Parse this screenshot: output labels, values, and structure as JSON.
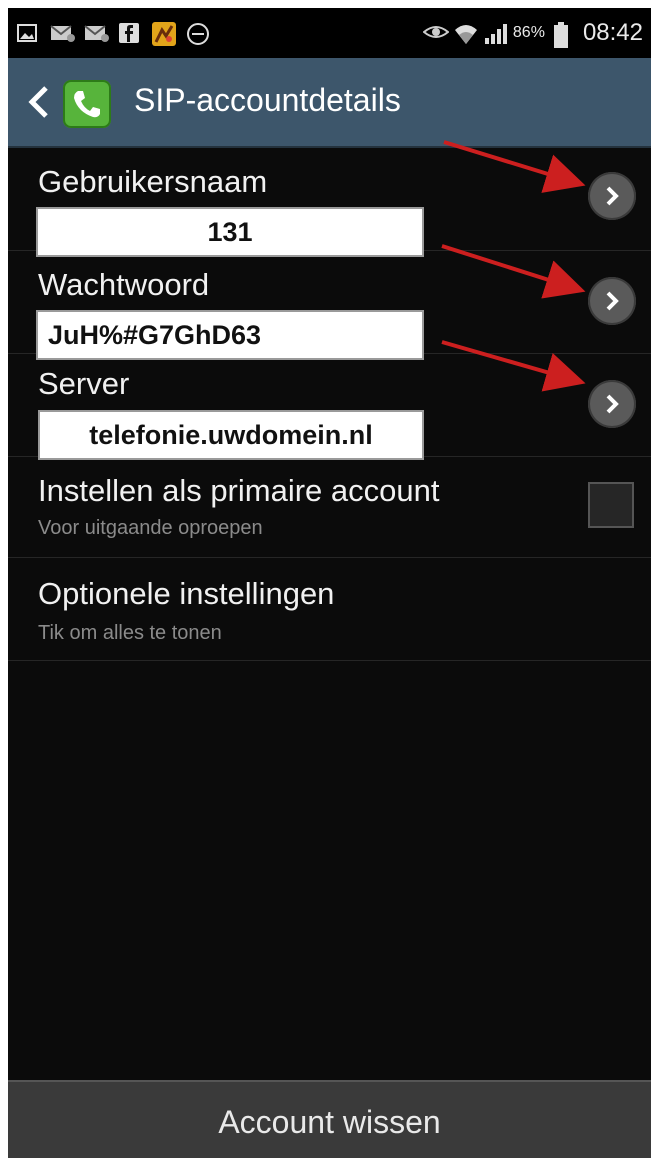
{
  "status_bar": {
    "notifications": [
      "image-icon",
      "mail-icon",
      "mail-icon",
      "facebook-icon",
      "app-icon",
      "do-not-disturb-icon"
    ],
    "battery_percent": "86%",
    "time": "08:42"
  },
  "action_bar": {
    "title": "SIP-accountdetails"
  },
  "fields": {
    "username": {
      "label": "Gebruikersnaam",
      "value": "131"
    },
    "password": {
      "label": "Wachtwoord",
      "value": "JuH%#G7GhD63"
    },
    "server": {
      "label": "Server",
      "value": "telefonie.uwdomein.nl"
    }
  },
  "primary_account": {
    "label": "Instellen als primaire account",
    "sublabel": "Voor uitgaande oproepen",
    "checked": false
  },
  "optional_settings": {
    "label": "Optionele instellingen",
    "sublabel": "Tik om alles te tonen"
  },
  "footer": {
    "button_label": "Account wissen"
  },
  "colors": {
    "action_bar": "#3d566b",
    "annotation_arrow": "#cc1f1f",
    "app_icon": "#57b43b"
  }
}
